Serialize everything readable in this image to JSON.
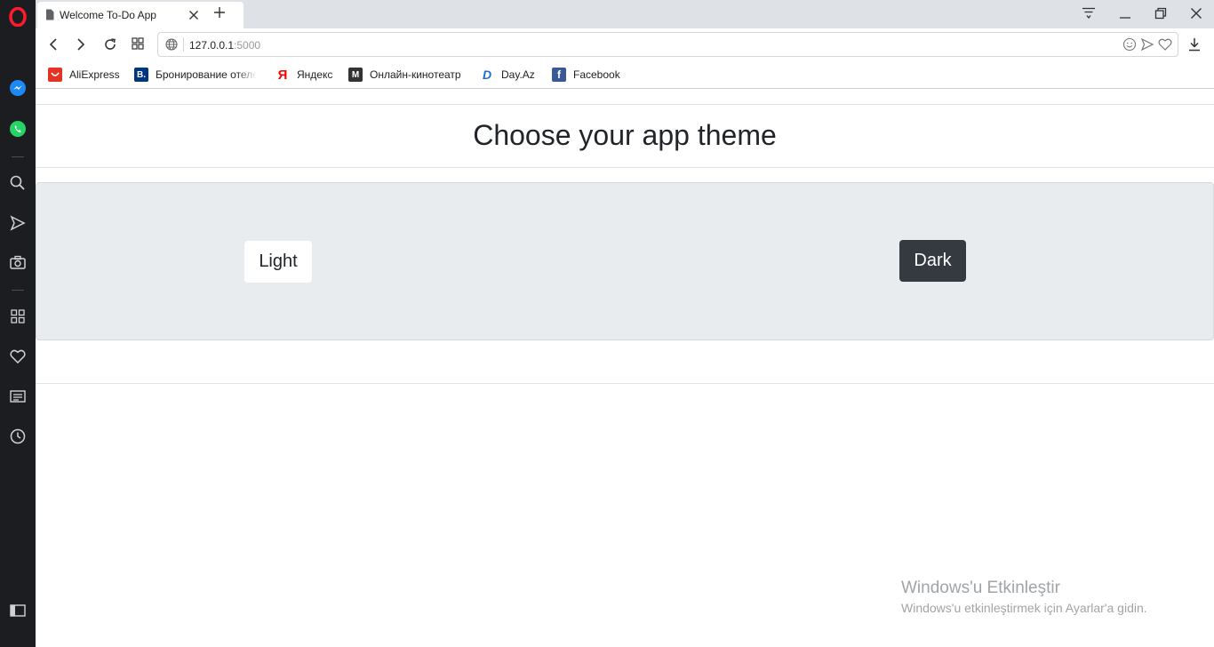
{
  "browser": {
    "tab_title": "Welcome To-Do App",
    "url_host": "127.0.0.1",
    "url_port": ":5000"
  },
  "bookmarks": [
    {
      "label": "AliExpress",
      "icon": "aliexpress-icon",
      "color": "#e43225"
    },
    {
      "label": "Бронирование отеле",
      "icon": "booking-icon",
      "color": "#003580"
    },
    {
      "label": "Яндекс",
      "icon": "yandex-icon",
      "color": "#ff0000"
    },
    {
      "label": "Онлайн-кинотеатр",
      "icon": "megogo-icon",
      "color": "#333333"
    },
    {
      "label": "Day.Az",
      "icon": "dayaz-icon",
      "color": "#1a6fd1"
    },
    {
      "label": "Facebook",
      "icon": "facebook-icon",
      "color": "#3b5998"
    }
  ],
  "page": {
    "title": "Choose your app theme",
    "light_label": "Light",
    "dark_label": "Dark"
  },
  "watermark": {
    "title": "Windows'u Etkinleştir",
    "subtitle": "Windows'u etkinleştirmek için Ayarlar'a gidin."
  },
  "colors": {
    "jumbotron_bg": "#e9ecef",
    "dark_button": "#343a40",
    "sidebar_bg": "#1b1d20",
    "opera_red": "#ff1b2d"
  }
}
